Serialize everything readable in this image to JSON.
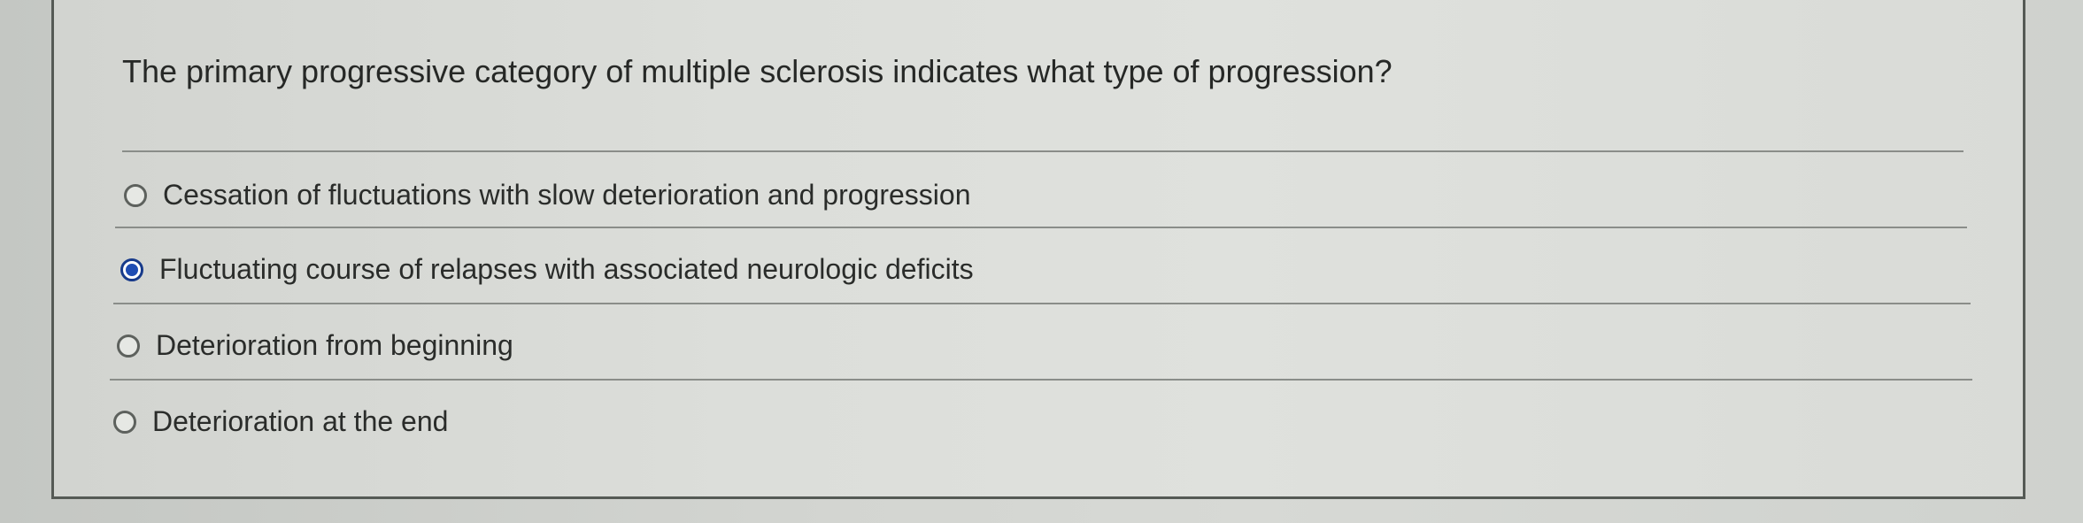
{
  "question": {
    "text": "The primary progressive category of multiple sclerosis indicates what type of progression?"
  },
  "options": [
    {
      "label": "Cessation of fluctuations with slow deterioration and progression",
      "selected": false
    },
    {
      "label": "Fluctuating course of relapses with associated neurologic deficits",
      "selected": true
    },
    {
      "label": "Deterioration from beginning",
      "selected": false
    },
    {
      "label": "Deterioration at the end",
      "selected": false
    }
  ],
  "colors": {
    "selected_radio": "#1f4db3",
    "text": "#2a2c2a"
  }
}
